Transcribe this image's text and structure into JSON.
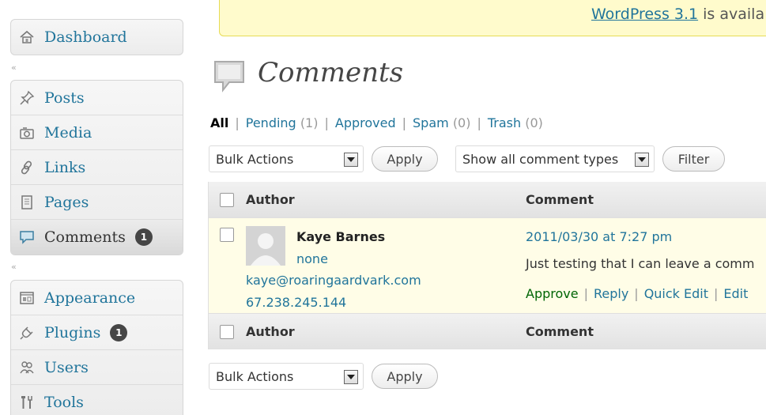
{
  "sidebar": {
    "dashboard": {
      "label": "Dashboard",
      "icon": "house-icon"
    },
    "posts": {
      "label": "Posts",
      "icon": "pushpin-icon"
    },
    "media": {
      "label": "Media",
      "icon": "camera-icon"
    },
    "links": {
      "label": "Links",
      "icon": "link-icon"
    },
    "pages": {
      "label": "Pages",
      "icon": "page-icon"
    },
    "comments": {
      "label": "Comments",
      "icon": "speech-bubble-icon",
      "badge": "1"
    },
    "appearance": {
      "label": "Appearance",
      "icon": "appearance-icon"
    },
    "plugins": {
      "label": "Plugins",
      "icon": "plug-icon",
      "badge": "1"
    },
    "users": {
      "label": "Users",
      "icon": "users-icon"
    },
    "tools": {
      "label": "Tools",
      "icon": "tools-icon"
    },
    "collapse_glyph": "«"
  },
  "notice": {
    "link": "WordPress 3.1",
    "text": " is availa"
  },
  "page": {
    "title": "Comments"
  },
  "filters": {
    "all": "All",
    "pending": "Pending",
    "pending_count": "(1)",
    "approved": "Approved",
    "spam": "Spam",
    "spam_count": "(0)",
    "trash": "Trash",
    "trash_count": "(0)",
    "sep": "|"
  },
  "controls": {
    "bulk_actions": "Bulk Actions",
    "apply": "Apply",
    "comment_types": "Show all comment types",
    "filter": "Filter"
  },
  "table": {
    "col_author": "Author",
    "col_comment": "Comment",
    "rows": [
      {
        "author_name": "Kaye Barnes",
        "author_url": "none",
        "author_email": "kaye@roaringaardvark.com",
        "author_ip": "67.238.245.144",
        "date": "2011/03/30 at 7:27 pm",
        "text": "Just testing that I can leave a comm",
        "actions": {
          "approve": "Approve",
          "reply": "Reply",
          "quick_edit": "Quick Edit",
          "edit": "Edit"
        }
      }
    ]
  },
  "colors": {
    "link": "#21759b",
    "approve": "#006505",
    "highlight_row": "#fffde7",
    "notice_bg": "#fffbcc"
  }
}
